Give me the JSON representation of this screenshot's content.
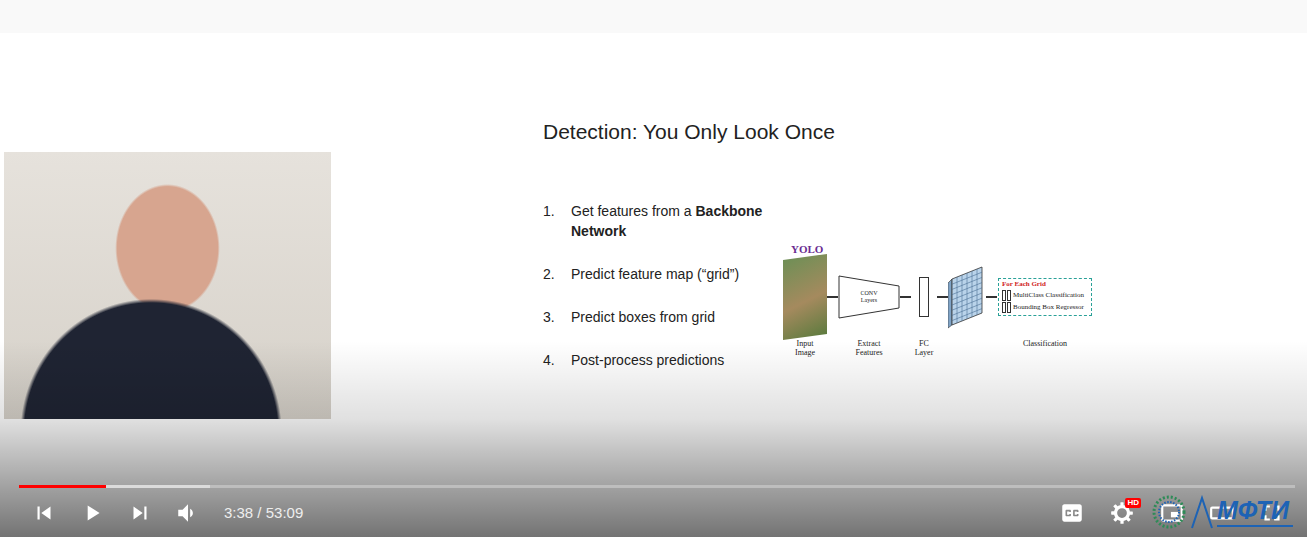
{
  "slide": {
    "title": "Detection: You Only Look Once",
    "steps": [
      {
        "number": "1.",
        "text": "Get features from a ",
        "emphasis": "Backbone Network"
      },
      {
        "number": "2.",
        "text": "Predict feature map (“grid”)"
      },
      {
        "number": "3.",
        "text": "Predict boxes from grid"
      },
      {
        "number": "4.",
        "text": "Post-process predictions"
      }
    ],
    "diagram": {
      "label": "YOLO",
      "input_caption": "Input Image",
      "conv_label": "CONV Layers",
      "conv_caption": "Extract Features",
      "fc_caption": "FC Layer",
      "output_header": "For Each Grid",
      "output_rows": [
        "MultiClass Classification",
        "Bounding Box Regressor"
      ],
      "output_caption": "Classification"
    }
  },
  "player": {
    "playing": false,
    "muted": false,
    "captions_on": false,
    "progress": {
      "level": 0.068,
      "buffered": 0.15
    },
    "time": "3:38 / 53:09",
    "quality_badge": "HD"
  },
  "watermark": "МФТИ"
}
